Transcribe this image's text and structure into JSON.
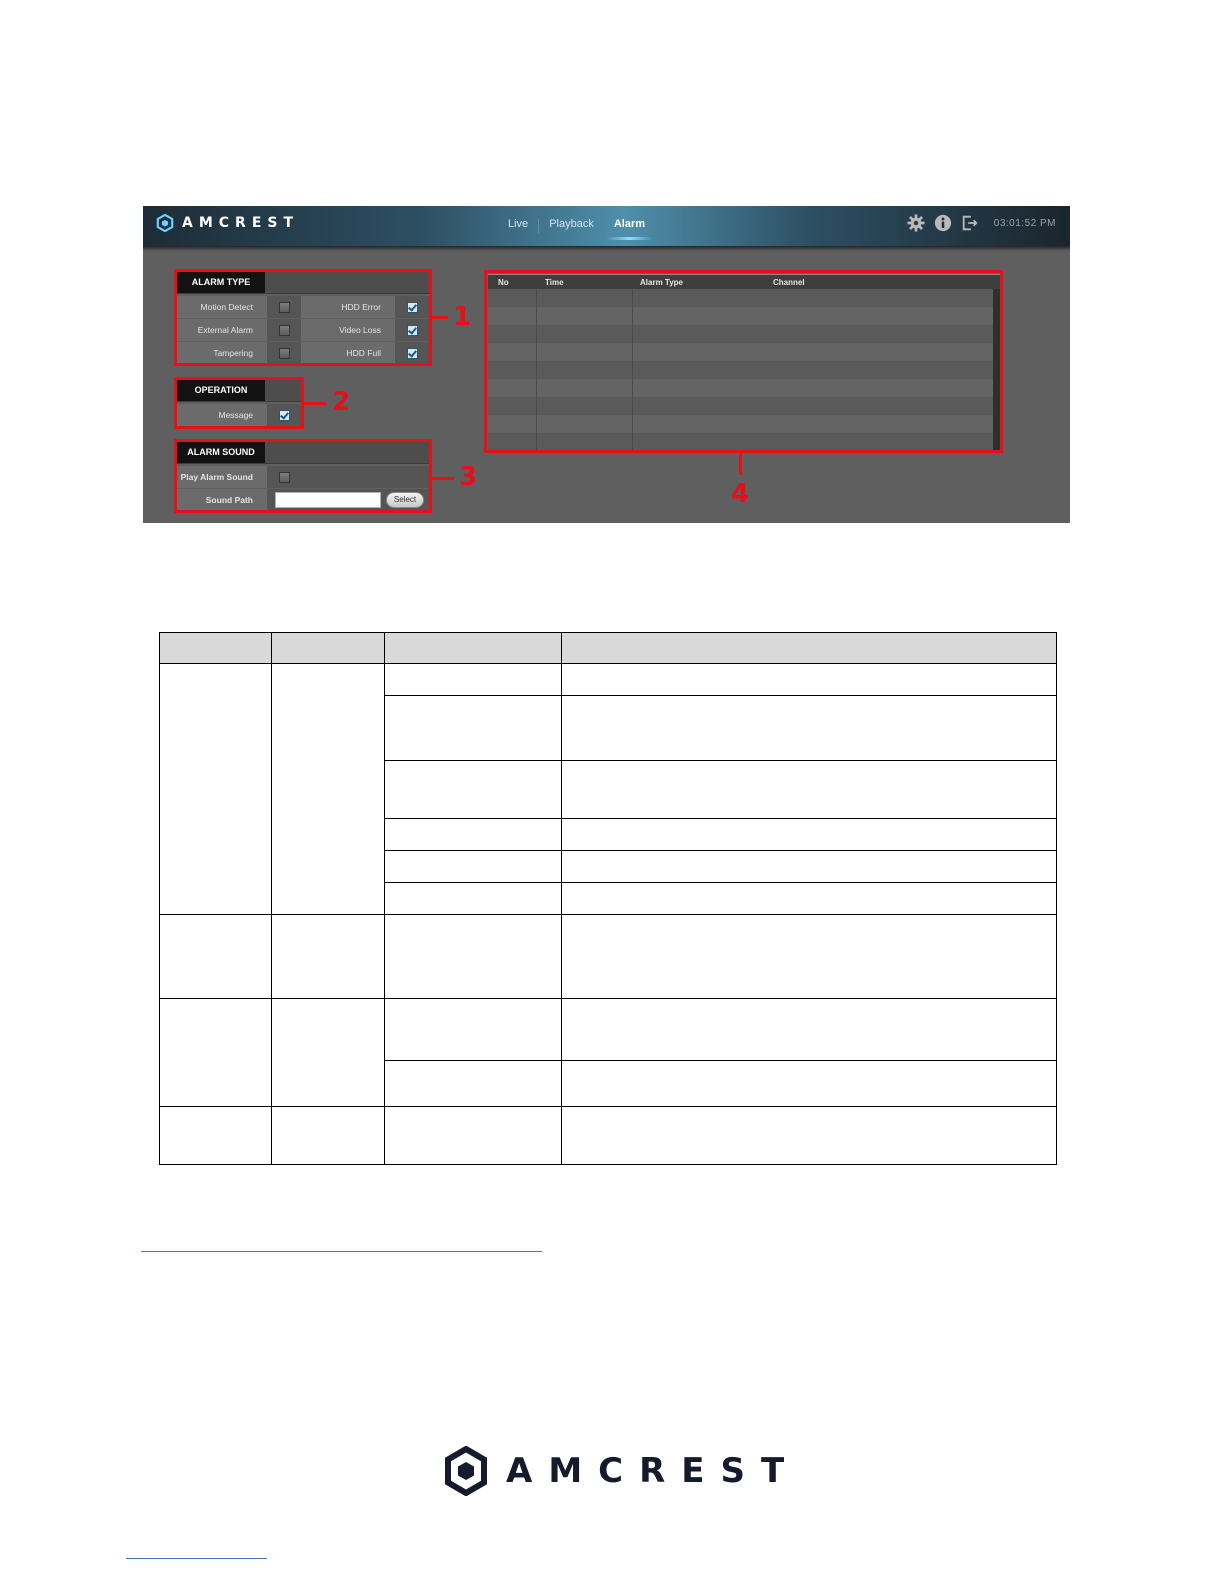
{
  "app": {
    "brand": "AMCREST",
    "nav": [
      {
        "label": "Live",
        "active": false
      },
      {
        "label": "Playback",
        "active": false
      },
      {
        "label": "Alarm",
        "active": true
      }
    ],
    "tools": [
      "gear-icon",
      "info-icon",
      "logout-icon"
    ],
    "clock": "03:01:52 PM"
  },
  "alarm_type": {
    "title": "ALARM TYPE",
    "rows": [
      {
        "left_label": "Motion Detect",
        "left_checked": false,
        "right_label": "HDD Error",
        "right_checked": true
      },
      {
        "left_label": "External Alarm",
        "left_checked": false,
        "right_label": "Video Loss",
        "right_checked": true
      },
      {
        "left_label": "Tampering",
        "left_checked": false,
        "right_label": "HDD Full",
        "right_checked": true
      }
    ]
  },
  "operation": {
    "title": "OPERATION",
    "message_label": "Message",
    "message_checked": true
  },
  "alarm_sound": {
    "title": "ALARM SOUND",
    "play_label": "Play Alarm Sound",
    "play_checked": false,
    "path_label": "Sound Path",
    "path_value": "",
    "select_label": "Select"
  },
  "alarm_list": {
    "columns": [
      "No",
      "Time",
      "Alarm Type",
      "Channel"
    ],
    "row_count": 9
  },
  "callouts": [
    "1",
    "2",
    "3",
    "4"
  ],
  "colors": {
    "callout": "#e4101a",
    "panel_bg": "#5f5f5f",
    "brand_dark": "#151a2c",
    "link_rule": "#4a76b0"
  },
  "footer": {
    "brand": "AMCREST"
  }
}
